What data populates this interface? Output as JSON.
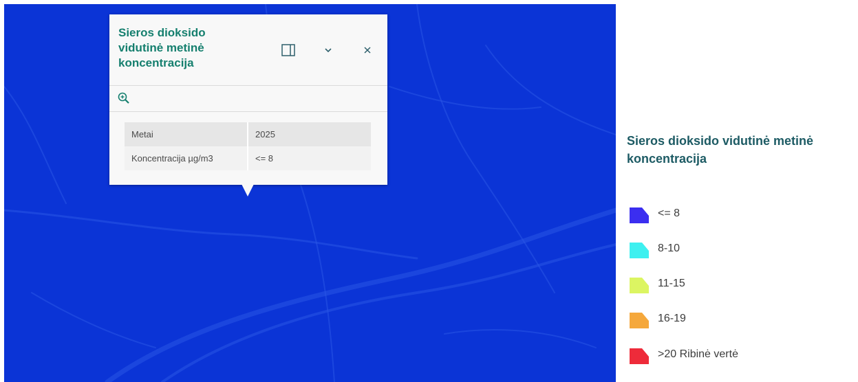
{
  "popup": {
    "title_lines": [
      "Sieros dioksido",
      "vidutinė metinė",
      "koncentracija"
    ],
    "buttons": {
      "dock": "dock-icon",
      "collapse": "chevron-down-icon",
      "close": "close-icon"
    },
    "zoom_icon": "zoom-in-icon",
    "attributes": [
      {
        "key": "Metai",
        "value": "2025"
      },
      {
        "key": "Koncentracija µg/m3",
        "value": "<= 8"
      }
    ],
    "colors": {
      "title": "#157f6e"
    }
  },
  "map": {
    "fill_color": "#0b34d6"
  },
  "legend": {
    "title": "Sieros dioksido vidutinė metinė koncentracija",
    "items": [
      {
        "label": "<= 8",
        "color": "#3b2ef0"
      },
      {
        "label": "8-10",
        "color": "#3ef0f0"
      },
      {
        "label": "11-15",
        "color": "#dcf562"
      },
      {
        "label": "16-19",
        "color": "#f5a83c"
      },
      {
        "label": ">20 Ribinė vertė",
        "color": "#ee2b3a"
      }
    ]
  }
}
